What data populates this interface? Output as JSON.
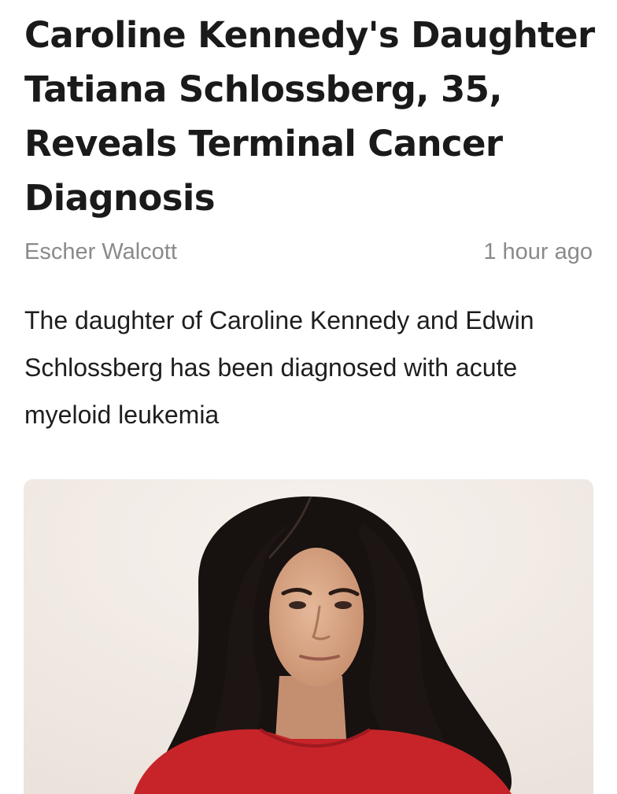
{
  "article": {
    "headline": "Caroline Kennedy's Daughter Tatiana Schlossberg, 35, Reveals Terminal Cancer Diagnosis",
    "author": "Escher Walcott",
    "timestamp": "1 hour ago",
    "dek": "The daughter of Caroline Kennedy and Ed­win Schlossberg has been diagnosed with acute myeloid leukemia"
  },
  "photo": {
    "background_color": "#f1ebe6",
    "hair_color": "#1a1412",
    "skin_color": "#d9a888",
    "dress_color": "#c8242a"
  }
}
